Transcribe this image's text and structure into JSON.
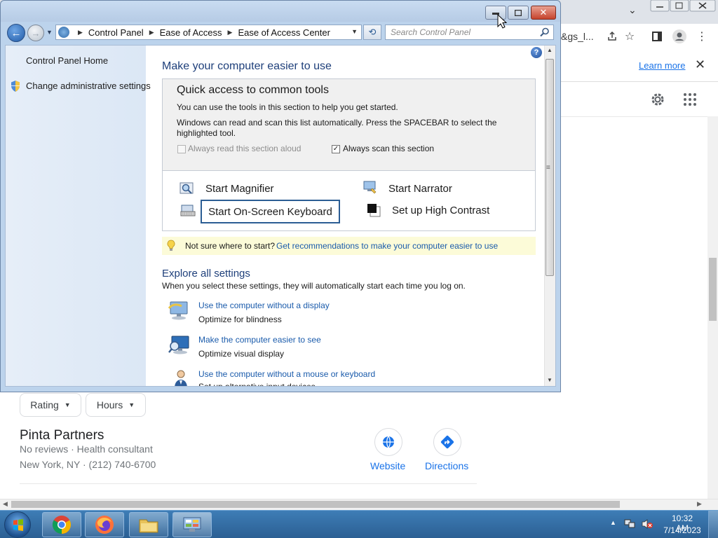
{
  "background_browser": {
    "url_fragment": "&gs_l...",
    "infobar": {
      "link": "Learn more"
    },
    "filters": {
      "rating": "Rating",
      "hours": "Hours"
    },
    "listing": {
      "name": "Pinta Partners",
      "line1": "No reviews · Health consultant",
      "line2": "New York, NY · (212) 740-6700",
      "website_label": "Website",
      "directions_label": "Directions"
    },
    "icons": [
      "share-icon",
      "star-icon",
      "sidebar-icon",
      "profile-icon",
      "kebab-menu-icon",
      "close-icon",
      "settings-gear-icon",
      "apps-grid-icon",
      "globe-icon",
      "directions-icon"
    ]
  },
  "window": {
    "address": {
      "crumbs": [
        "Control Panel",
        "Ease of Access",
        "Ease of Access Center"
      ]
    },
    "search_placeholder": "Search Control Panel",
    "sidebar": {
      "home": "Control Panel Home",
      "admin": "Change administrative settings"
    },
    "main": {
      "heading": "Make your computer easier to use",
      "quick_access": {
        "title": "Quick access to common tools",
        "line1": "You can use the tools in this section to help you get started.",
        "line2": "Windows can read and scan this list automatically.  Press the SPACEBAR to select the highlighted tool.",
        "chk_read": {
          "label": "Always read this section aloud",
          "checked": false,
          "enabled": false
        },
        "chk_scan": {
          "label": "Always scan this section",
          "checked": true
        }
      },
      "tools": {
        "magnifier": "Start Magnifier",
        "narrator": "Start Narrator",
        "osk": "Start On-Screen Keyboard",
        "contrast": "Set up High Contrast"
      },
      "tip": {
        "text": "Not sure where to start?",
        "link": "Get recommendations to make your computer easier to use"
      },
      "explore": {
        "heading": "Explore all settings",
        "sub": "When you select these settings, they will automatically start each time you log on.",
        "items": [
          {
            "link": "Use the computer without a display",
            "desc": "Optimize for blindness"
          },
          {
            "link": "Make the computer easier to see",
            "desc": "Optimize visual display"
          },
          {
            "link": "Use the computer without a mouse or keyboard",
            "desc": "Set up alternative input devices"
          }
        ]
      }
    }
  },
  "taskbar": {
    "apps": [
      "Google Chrome",
      "Firefox",
      "Windows Explorer",
      "Control Panel"
    ],
    "clock": {
      "time": "10:32 AM",
      "date": "7/14/2023"
    }
  },
  "colors": {
    "window_frame": "#bcd3ec",
    "link": "#1a5bab",
    "heading": "#1e3f7a",
    "taskbar": "#2b5f93",
    "chrome_link": "#1a73e8"
  }
}
